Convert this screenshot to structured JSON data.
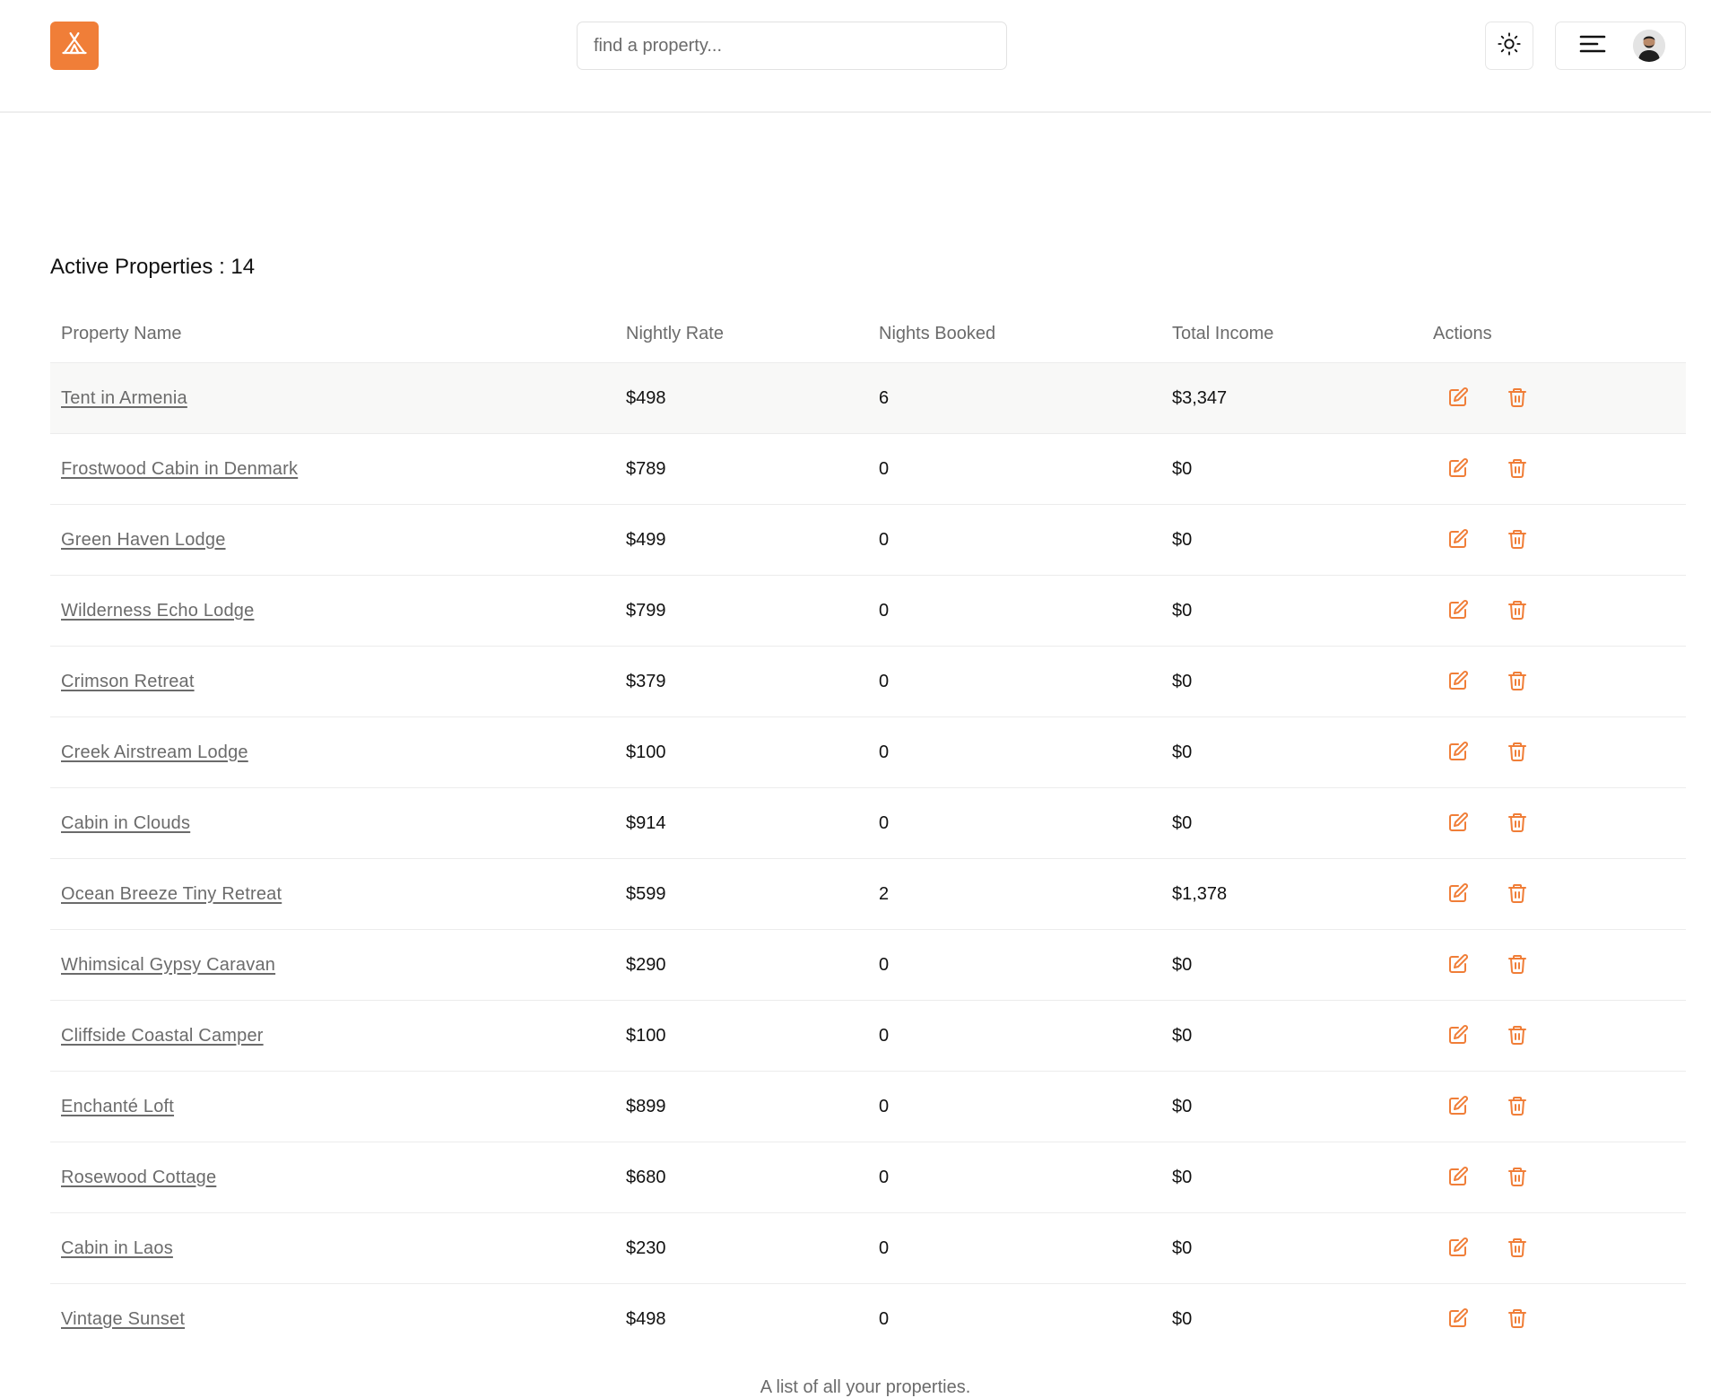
{
  "header": {
    "search_placeholder": "find a property...",
    "accent_color": "#f07e38",
    "icons": [
      "tent-logo-icon",
      "sun-icon",
      "menu-icon",
      "avatar"
    ]
  },
  "main": {
    "title": "Active Properties : 14",
    "columns": [
      "Property Name",
      "Nightly Rate",
      "Nights Booked",
      "Total Income",
      "Actions"
    ],
    "rows": [
      {
        "name": "Tent in Armenia",
        "rate": "$498",
        "nights": "6",
        "income": "$3,347"
      },
      {
        "name": "Frostwood Cabin in Denmark",
        "rate": "$789",
        "nights": "0",
        "income": "$0"
      },
      {
        "name": "Green Haven Lodge",
        "rate": "$499",
        "nights": "0",
        "income": "$0"
      },
      {
        "name": "Wilderness Echo Lodge",
        "rate": "$799",
        "nights": "0",
        "income": "$0"
      },
      {
        "name": "Crimson Retreat",
        "rate": "$379",
        "nights": "0",
        "income": "$0"
      },
      {
        "name": "Creek Airstream Lodge",
        "rate": "$100",
        "nights": "0",
        "income": "$0"
      },
      {
        "name": "Cabin in Clouds",
        "rate": "$914",
        "nights": "0",
        "income": "$0"
      },
      {
        "name": "Ocean Breeze Tiny Retreat",
        "rate": "$599",
        "nights": "2",
        "income": "$1,378"
      },
      {
        "name": "Whimsical Gypsy Caravan",
        "rate": "$290",
        "nights": "0",
        "income": "$0"
      },
      {
        "name": "Cliffside Coastal Camper",
        "rate": "$100",
        "nights": "0",
        "income": "$0"
      },
      {
        "name": "Enchanté Loft",
        "rate": "$899",
        "nights": "0",
        "income": "$0"
      },
      {
        "name": "Rosewood Cottage",
        "rate": "$680",
        "nights": "0",
        "income": "$0"
      },
      {
        "name": "Cabin in Laos",
        "rate": "$230",
        "nights": "0",
        "income": "$0"
      },
      {
        "name": "Vintage Sunset",
        "rate": "$498",
        "nights": "0",
        "income": "$0"
      }
    ],
    "row_icons": [
      "edit-icon",
      "trash-icon"
    ],
    "caption": "A list of all your properties."
  }
}
